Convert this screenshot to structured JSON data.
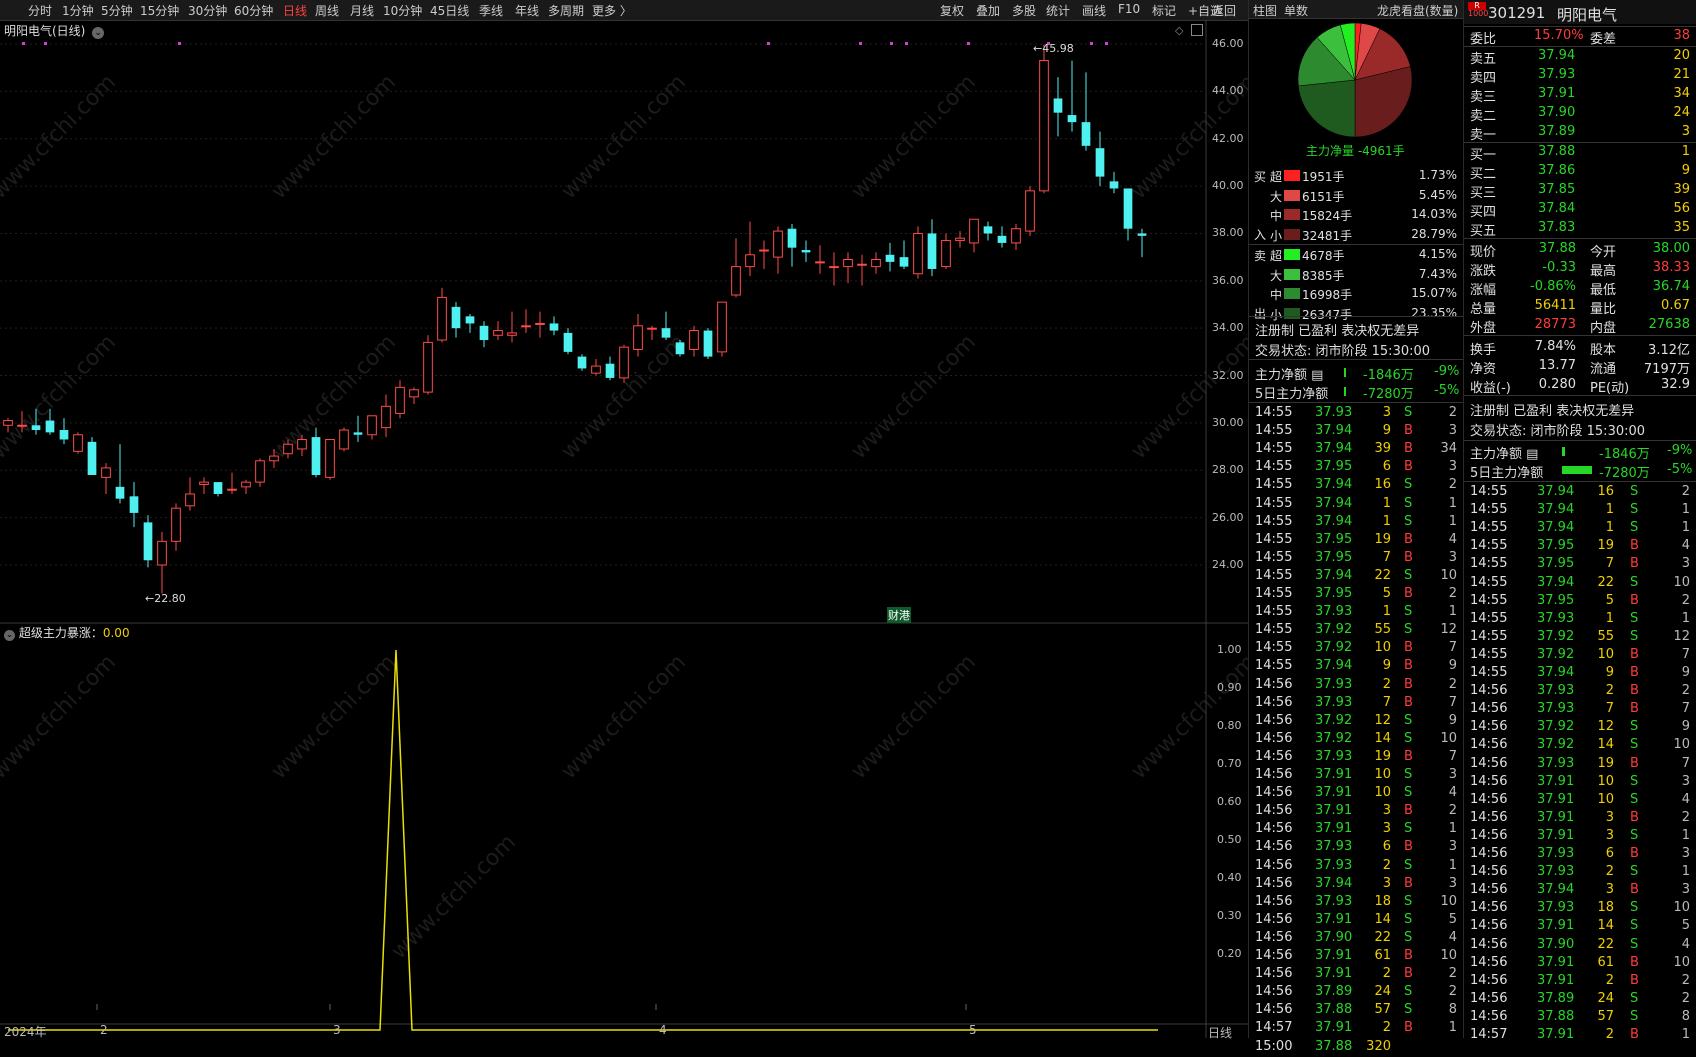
{
  "toolbar": {
    "periods": [
      "分时",
      "1分钟",
      "5分钟",
      "15分钟",
      "30分钟",
      "60分钟",
      "日线",
      "周线",
      "月线",
      "10分钟",
      "45日线",
      "季线",
      "年线",
      "多周期",
      "更多 〉"
    ],
    "active_period": "日线",
    "actions": [
      "复权",
      "叠加",
      "多股",
      "统计",
      "画线",
      "F10",
      "标记",
      "+自选",
      "返回"
    ]
  },
  "chart_title": "明阳电气(日线)",
  "price_axis": [
    "46.00",
    "44.00",
    "42.00",
    "40.00",
    "38.00",
    "36.00",
    "34.00",
    "32.00",
    "30.00",
    "28.00",
    "26.00",
    "24.00"
  ],
  "high_marker": "45.98",
  "low_marker": "22.80",
  "caigang_tag": "财港",
  "indicator": {
    "name": "超级主力暴涨",
    "value": "0.00"
  },
  "indicator_axis": [
    "1.00",
    "0.90",
    "0.80",
    "0.70",
    "0.60",
    "0.50",
    "0.40",
    "0.30",
    "0.20"
  ],
  "x_axis": [
    "2024年",
    "2",
    "3",
    "4",
    "5"
  ],
  "x_axis_right": "日线",
  "chart_data": {
    "type": "candlestick",
    "ylim": [
      22,
      47
    ],
    "candles": [
      [
        29.9,
        30.1,
        29.6,
        30.2
      ],
      [
        29.9,
        29.9,
        29.6,
        30.5
      ],
      [
        29.9,
        29.7,
        29.5,
        30.6
      ],
      [
        30.1,
        29.6,
        29.5,
        30.6
      ],
      [
        29.7,
        29.3,
        29.1,
        30.2
      ],
      [
        28.8,
        29.5,
        28.7,
        29.6
      ],
      [
        29.2,
        27.8,
        27.8,
        29.4
      ],
      [
        27.7,
        28.1,
        27.0,
        28.3
      ],
      [
        27.3,
        26.8,
        26.6,
        29.1
      ],
      [
        26.9,
        26.2,
        25.6,
        27.5
      ],
      [
        25.8,
        24.2,
        23.9,
        26.1
      ],
      [
        24.0,
        25.0,
        22.8,
        25.4
      ],
      [
        25.0,
        26.4,
        24.6,
        26.6
      ],
      [
        26.5,
        27.0,
        26.3,
        27.7
      ],
      [
        27.4,
        27.5,
        27.0,
        27.7
      ],
      [
        27.5,
        27.0,
        26.9,
        27.5
      ],
      [
        27.2,
        27.2,
        27.0,
        27.9
      ],
      [
        27.3,
        27.5,
        27.0,
        27.6
      ],
      [
        27.5,
        28.4,
        27.3,
        28.5
      ],
      [
        28.4,
        28.6,
        28.1,
        28.9
      ],
      [
        28.7,
        29.1,
        28.5,
        29.3
      ],
      [
        28.9,
        29.3,
        28.6,
        29.5
      ],
      [
        29.4,
        27.8,
        27.7,
        29.8
      ],
      [
        27.7,
        29.3,
        27.6,
        29.3
      ],
      [
        28.9,
        29.7,
        28.8,
        29.8
      ],
      [
        29.6,
        29.5,
        29.2,
        30.3
      ],
      [
        29.5,
        30.3,
        29.3,
        30.3
      ],
      [
        29.8,
        30.7,
        29.4,
        31.2
      ],
      [
        30.4,
        31.5,
        30.2,
        31.8
      ],
      [
        31.1,
        31.4,
        30.8,
        31.5
      ],
      [
        31.3,
        33.4,
        31.2,
        33.7
      ],
      [
        33.5,
        35.3,
        33.4,
        35.7
      ],
      [
        34.9,
        34.0,
        33.6,
        35.1
      ],
      [
        34.5,
        34.2,
        33.8,
        34.6
      ],
      [
        34.1,
        33.5,
        33.2,
        34.3
      ],
      [
        33.7,
        33.9,
        33.5,
        34.3
      ],
      [
        33.7,
        33.8,
        33.4,
        34.7
      ],
      [
        34.1,
        34.1,
        33.8,
        34.8
      ],
      [
        34.2,
        34.2,
        33.6,
        34.7
      ],
      [
        34.2,
        33.9,
        33.7,
        34.5
      ],
      [
        33.8,
        33.0,
        32.9,
        34.0
      ],
      [
        32.8,
        32.3,
        32.2,
        32.9
      ],
      [
        32.1,
        32.4,
        32.0,
        32.7
      ],
      [
        32.5,
        31.9,
        31.8,
        32.8
      ],
      [
        31.9,
        33.2,
        31.7,
        33.3
      ],
      [
        33.1,
        34.1,
        32.8,
        34.6
      ],
      [
        34.0,
        34.0,
        33.5,
        34.1
      ],
      [
        34.0,
        33.6,
        33.5,
        34.7
      ],
      [
        33.4,
        32.9,
        32.8,
        33.5
      ],
      [
        33.1,
        33.9,
        32.8,
        34.1
      ],
      [
        33.9,
        32.8,
        32.7,
        34.0
      ],
      [
        33.0,
        35.1,
        32.8,
        35.1
      ],
      [
        35.4,
        36.6,
        35.3,
        37.8
      ],
      [
        36.6,
        37.1,
        36.2,
        38.5
      ],
      [
        37.3,
        37.3,
        36.5,
        37.7
      ],
      [
        37.0,
        38.1,
        36.3,
        38.3
      ],
      [
        38.2,
        37.4,
        36.6,
        38.4
      ],
      [
        37.3,
        37.2,
        36.8,
        37.7
      ],
      [
        36.8,
        36.8,
        36.3,
        37.5
      ],
      [
        36.6,
        36.6,
        35.8,
        37.2
      ],
      [
        36.6,
        36.9,
        35.9,
        37.2
      ],
      [
        36.7,
        36.7,
        35.8,
        37.1
      ],
      [
        36.6,
        36.9,
        36.3,
        37.2
      ],
      [
        37.1,
        36.8,
        36.4,
        37.6
      ],
      [
        37.0,
        36.6,
        36.5,
        37.7
      ],
      [
        36.3,
        38.0,
        36.1,
        38.3
      ],
      [
        38.0,
        36.5,
        36.2,
        38.6
      ],
      [
        36.6,
        37.7,
        36.5,
        38.0
      ],
      [
        37.7,
        37.8,
        37.4,
        38.1
      ],
      [
        37.6,
        38.6,
        37.2,
        38.6
      ],
      [
        38.3,
        38.0,
        37.7,
        38.5
      ],
      [
        37.9,
        37.6,
        37.4,
        38.3
      ],
      [
        37.6,
        38.2,
        37.3,
        38.4
      ],
      [
        38.1,
        39.8,
        37.9,
        40.0
      ],
      [
        39.8,
        45.3,
        39.7,
        45.98
      ],
      [
        43.7,
        43.1,
        42.1,
        44.6
      ],
      [
        43.0,
        42.7,
        42.3,
        45.3
      ],
      [
        42.7,
        41.7,
        41.5,
        44.8
      ],
      [
        41.6,
        40.4,
        40.0,
        42.3
      ],
      [
        40.2,
        39.9,
        39.7,
        40.6
      ],
      [
        39.9,
        38.2,
        37.7,
        39.9
      ],
      [
        38.0,
        37.9,
        37.0,
        38.2
      ]
    ]
  },
  "indicator_chart": {
    "type": "line",
    "values": [
      0,
      0,
      0,
      0,
      0,
      0,
      0,
      0,
      0,
      0,
      0,
      0,
      0,
      0,
      0,
      0,
      0,
      0,
      0,
      0,
      0,
      0,
      0,
      0,
      0,
      1,
      0,
      0,
      0,
      0,
      0,
      0,
      0,
      0,
      0,
      0,
      0,
      0,
      0,
      0,
      0,
      0,
      0,
      0,
      0,
      0,
      0,
      0,
      0,
      0,
      0,
      0,
      0,
      0,
      0,
      0,
      0,
      0,
      0,
      0,
      0,
      0,
      0,
      0,
      0,
      0,
      0,
      0,
      0,
      0,
      0,
      0,
      0,
      0,
      0,
      0,
      0,
      0,
      0,
      0,
      0,
      0
    ],
    "peak_index": 25,
    "ylim": [
      0,
      1.05
    ]
  },
  "mid_panel": {
    "tabs": [
      "柱图",
      "单数",
      "龙虎看盘(数量)"
    ],
    "pie_label": "主力净量 -4961手",
    "buy_label": [
      "买",
      "入"
    ],
    "sell_label": [
      "卖",
      "出"
    ],
    "buy_rows": [
      {
        "size": "超",
        "qty": "1951手",
        "pct": "1.73%",
        "color": "#ff2020"
      },
      {
        "size": "大",
        "qty": "6151手",
        "pct": "5.45%",
        "color": "#e04848"
      },
      {
        "size": "中",
        "qty": "15824手",
        "pct": "14.03%",
        "color": "#9a2a2a"
      },
      {
        "size": "小",
        "qty": "32481手",
        "pct": "28.79%",
        "color": "#6a1d1d"
      }
    ],
    "sell_rows": [
      {
        "size": "超",
        "qty": "4678手",
        "pct": "4.15%",
        "color": "#22ee22"
      },
      {
        "size": "大",
        "qty": "8385手",
        "pct": "7.43%",
        "color": "#3cbf3c"
      },
      {
        "size": "中",
        "qty": "16998手",
        "pct": "15.07%",
        "color": "#2e8a2e"
      },
      {
        "size": "小",
        "qty": "26347手",
        "pct": "23.35%",
        "color": "#1f5a1f"
      }
    ],
    "pie_slices": [
      1.73,
      5.45,
      14.03,
      28.79,
      23.35,
      15.07,
      7.43,
      4.15
    ],
    "pie_colors": [
      "#ff2020",
      "#e04848",
      "#9a2a2a",
      "#6a1d1d",
      "#1f5a1f",
      "#2e8a2e",
      "#3cbf3c",
      "#22ee22"
    ],
    "reg_text": "注册制 已盈利 表决权无差异",
    "status_text": "交易状态: 闭市阶段 15:30:00",
    "net1_label": "主力净额",
    "net1_val": "-1846万",
    "net1_pct": "-9%",
    "net2_label": "5日主力净额",
    "net2_val": "-7280万",
    "net2_pct": "-5%",
    "trades": [
      [
        "14:55",
        "37.93",
        "3",
        "S",
        "2"
      ],
      [
        "14:55",
        "37.94",
        "9",
        "B",
        "3"
      ],
      [
        "14:55",
        "37.94",
        "39",
        "B",
        "34"
      ],
      [
        "14:55",
        "37.95",
        "6",
        "B",
        "3"
      ],
      [
        "14:55",
        "37.94",
        "16",
        "S",
        "2"
      ],
      [
        "14:55",
        "37.94",
        "1",
        "S",
        "1"
      ],
      [
        "14:55",
        "37.94",
        "1",
        "S",
        "1"
      ],
      [
        "14:55",
        "37.95",
        "19",
        "B",
        "4"
      ],
      [
        "14:55",
        "37.95",
        "7",
        "B",
        "3"
      ],
      [
        "14:55",
        "37.94",
        "22",
        "S",
        "10"
      ],
      [
        "14:55",
        "37.95",
        "5",
        "B",
        "2"
      ],
      [
        "14:55",
        "37.93",
        "1",
        "S",
        "1"
      ],
      [
        "14:55",
        "37.92",
        "55",
        "S",
        "12"
      ],
      [
        "14:55",
        "37.92",
        "10",
        "B",
        "7"
      ],
      [
        "14:55",
        "37.94",
        "9",
        "B",
        "9"
      ],
      [
        "14:56",
        "37.93",
        "2",
        "B",
        "2"
      ],
      [
        "14:56",
        "37.93",
        "7",
        "B",
        "7"
      ],
      [
        "14:56",
        "37.92",
        "12",
        "S",
        "9"
      ],
      [
        "14:56",
        "37.92",
        "14",
        "S",
        "10"
      ],
      [
        "14:56",
        "37.93",
        "19",
        "B",
        "7"
      ],
      [
        "14:56",
        "37.91",
        "10",
        "S",
        "3"
      ],
      [
        "14:56",
        "37.91",
        "10",
        "S",
        "4"
      ],
      [
        "14:56",
        "37.91",
        "3",
        "B",
        "2"
      ],
      [
        "14:56",
        "37.91",
        "3",
        "S",
        "1"
      ],
      [
        "14:56",
        "37.93",
        "6",
        "B",
        "3"
      ],
      [
        "14:56",
        "37.93",
        "2",
        "S",
        "1"
      ],
      [
        "14:56",
        "37.94",
        "3",
        "B",
        "3"
      ],
      [
        "14:56",
        "37.93",
        "18",
        "S",
        "10"
      ],
      [
        "14:56",
        "37.91",
        "14",
        "S",
        "5"
      ],
      [
        "14:56",
        "37.90",
        "22",
        "S",
        "4"
      ],
      [
        "14:56",
        "37.91",
        "61",
        "B",
        "10"
      ],
      [
        "14:56",
        "37.91",
        "2",
        "B",
        "2"
      ],
      [
        "14:56",
        "37.89",
        "24",
        "S",
        "2"
      ],
      [
        "14:56",
        "37.88",
        "57",
        "S",
        "8"
      ],
      [
        "14:57",
        "37.91",
        "2",
        "B",
        "1"
      ],
      [
        "15:00",
        "37.88",
        "320",
        "",
        ""
      ]
    ]
  },
  "right_panel": {
    "code": "301291",
    "name": "明阳电气",
    "badge_top": "R",
    "badge_bottom": "1000",
    "weibi_label": "委比",
    "weibi": "15.70%",
    "weicha_label": "委差",
    "weicha": "38",
    "sells": [
      {
        "label": "卖五",
        "price": "37.94",
        "vol": "20"
      },
      {
        "label": "卖四",
        "price": "37.93",
        "vol": "21"
      },
      {
        "label": "卖三",
        "price": "37.91",
        "vol": "34"
      },
      {
        "label": "卖二",
        "price": "37.90",
        "vol": "24"
      },
      {
        "label": "卖一",
        "price": "37.89",
        "vol": "3"
      }
    ],
    "buys": [
      {
        "label": "买一",
        "price": "37.88",
        "vol": "1"
      },
      {
        "label": "买二",
        "price": "37.86",
        "vol": "9"
      },
      {
        "label": "买三",
        "price": "37.85",
        "vol": "39"
      },
      {
        "label": "买四",
        "price": "37.84",
        "vol": "56"
      },
      {
        "label": "买五",
        "price": "37.83",
        "vol": "35"
      }
    ],
    "stats": [
      {
        "l1": "现价",
        "v1": "37.88",
        "c1": "grn",
        "l2": "今开",
        "v2": "38.00",
        "c2": "grn"
      },
      {
        "l1": "涨跌",
        "v1": "-0.33",
        "c1": "grn",
        "l2": "最高",
        "v2": "38.33",
        "c2": "red"
      },
      {
        "l1": "涨幅",
        "v1": "-0.86%",
        "c1": "grn",
        "l2": "最低",
        "v2": "36.74",
        "c2": "grn"
      },
      {
        "l1": "总量",
        "v1": "56411",
        "c1": "yel",
        "l2": "量比",
        "v2": "0.67",
        "c2": "yel"
      },
      {
        "l1": "外盘",
        "v1": "28773",
        "c1": "red",
        "l2": "内盘",
        "v2": "27638",
        "c2": "grn"
      }
    ],
    "stats2": [
      {
        "l1": "换手",
        "v1": "7.84%",
        "l2": "股本",
        "v2": "3.12亿"
      },
      {
        "l1": "净资",
        "v1": "13.77",
        "l2": "流通",
        "v2": "7197万"
      },
      {
        "l1": "收益(-)",
        "v1": "0.280",
        "l2": "PE(动)",
        "v2": "32.9"
      }
    ],
    "reg_text": "注册制 已盈利 表决权无差异",
    "status_text": "交易状态: 闭市阶段 15:30:00",
    "net1_label": "主力净额",
    "net1_val": "-1846万",
    "net1_pct": "-9%",
    "net2_label": "5日主力净额",
    "net2_val": "-7280万",
    "net2_pct": "-5%",
    "trades": [
      [
        "14:55",
        "37.94",
        "16",
        "S",
        "2"
      ],
      [
        "14:55",
        "37.94",
        "1",
        "S",
        "1"
      ],
      [
        "14:55",
        "37.94",
        "1",
        "S",
        "1"
      ],
      [
        "14:55",
        "37.95",
        "19",
        "B",
        "4"
      ],
      [
        "14:55",
        "37.95",
        "7",
        "B",
        "3"
      ],
      [
        "14:55",
        "37.94",
        "22",
        "S",
        "10"
      ],
      [
        "14:55",
        "37.95",
        "5",
        "B",
        "2"
      ],
      [
        "14:55",
        "37.93",
        "1",
        "S",
        "1"
      ],
      [
        "14:55",
        "37.92",
        "55",
        "S",
        "12"
      ],
      [
        "14:55",
        "37.92",
        "10",
        "B",
        "7"
      ],
      [
        "14:55",
        "37.94",
        "9",
        "B",
        "9"
      ],
      [
        "14:56",
        "37.93",
        "2",
        "B",
        "2"
      ],
      [
        "14:56",
        "37.93",
        "7",
        "B",
        "7"
      ],
      [
        "14:56",
        "37.92",
        "12",
        "S",
        "9"
      ],
      [
        "14:56",
        "37.92",
        "14",
        "S",
        "10"
      ],
      [
        "14:56",
        "37.93",
        "19",
        "B",
        "7"
      ],
      [
        "14:56",
        "37.91",
        "10",
        "S",
        "3"
      ],
      [
        "14:56",
        "37.91",
        "10",
        "S",
        "4"
      ],
      [
        "14:56",
        "37.91",
        "3",
        "B",
        "2"
      ],
      [
        "14:56",
        "37.91",
        "3",
        "S",
        "1"
      ],
      [
        "14:56",
        "37.93",
        "6",
        "B",
        "3"
      ],
      [
        "14:56",
        "37.93",
        "2",
        "S",
        "1"
      ],
      [
        "14:56",
        "37.94",
        "3",
        "B",
        "3"
      ],
      [
        "14:56",
        "37.93",
        "18",
        "S",
        "10"
      ],
      [
        "14:56",
        "37.91",
        "14",
        "S",
        "5"
      ],
      [
        "14:56",
        "37.90",
        "22",
        "S",
        "4"
      ],
      [
        "14:56",
        "37.91",
        "61",
        "B",
        "10"
      ],
      [
        "14:56",
        "37.91",
        "2",
        "B",
        "2"
      ],
      [
        "14:56",
        "37.89",
        "24",
        "S",
        "2"
      ],
      [
        "14:56",
        "37.88",
        "57",
        "S",
        "8"
      ],
      [
        "14:57",
        "37.91",
        "2",
        "B",
        "1"
      ]
    ]
  },
  "watermark": "www.cfchi.com"
}
